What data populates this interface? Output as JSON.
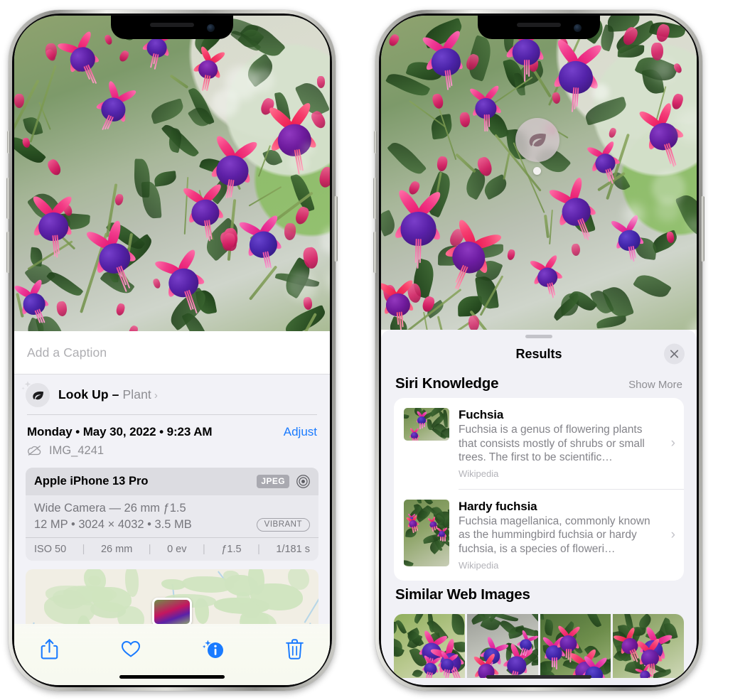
{
  "left_phone": {
    "name": "iPhone photo detail view",
    "photo": {
      "alt": "Fuchsia flowers hanging basket"
    },
    "caption_field": {
      "placeholder": "Add a Caption",
      "value": ""
    },
    "look_up": {
      "icon": "leaf-icon",
      "sparkle_icon": "sparkles-icon",
      "label": "Look Up",
      "separator": "–",
      "subject": "Plant",
      "chevron": "›"
    },
    "date_row": {
      "date": "Monday • May 30, 2022 • 9:23 AM",
      "adjust_label": "Adjust"
    },
    "file_row": {
      "icon": "cloud-slash-icon",
      "filename": "IMG_4241"
    },
    "exif": {
      "device": "Apple iPhone 13 Pro",
      "format_badge": "JPEG",
      "aperture_icon": "lens-icon",
      "lens": "Wide Camera — 26 mm ƒ1.5",
      "size_line": "12 MP • 3024 × 4032 • 3.5 MB",
      "style_badge": "VIBRANT",
      "settings": [
        "ISO 50",
        "26 mm",
        "0 ev",
        "ƒ1.5",
        "1/181 s"
      ]
    },
    "map": {
      "alt": "Map showing photo location",
      "pin": "photo-thumbnail-pin"
    },
    "toolbar": [
      {
        "name": "share-button",
        "icon": "share-icon"
      },
      {
        "name": "favorite-button",
        "icon": "heart-icon"
      },
      {
        "name": "info-button",
        "icon": "info-sparkle-icon"
      },
      {
        "name": "delete-button",
        "icon": "trash-icon"
      }
    ],
    "accent_color": "#1a7bff"
  },
  "right_phone": {
    "name": "Visual Look Up results",
    "visual_lookup_badge": {
      "icon": "leaf-icon",
      "label": "Visual Look Up"
    },
    "results_sheet": {
      "grabber": "drag-handle",
      "title": "Results",
      "close_icon": "close-icon",
      "sections": [
        {
          "title": "Siri Knowledge",
          "action_label": "Show More",
          "items": [
            {
              "title": "Fuchsia",
              "description": "Fuchsia is a genus of flowering plants that consists mostly of shrubs or small trees. The first to be scientific…",
              "source": "Wikipedia",
              "thumb": "fuchsia-red-flowers-thumbnail",
              "chevron": "›"
            },
            {
              "title": "Hardy fuchsia",
              "description": "Fuchsia magellanica, commonly known as the hummingbird fuchsia or hardy fuchsia, is a species of floweri…",
              "source": "Wikipedia",
              "thumb": "hardy-fuchsia-branch-thumbnail",
              "chevron": "›"
            }
          ]
        },
        {
          "title": "Similar Web Images",
          "images": [
            {
              "alt": "Pink and magenta fuchsia with green leaves"
            },
            {
              "alt": "Close-up of red fuchsia blossoms"
            },
            {
              "alt": "Fuchsia shrub with many buds"
            },
            {
              "alt": "Purple and red fuchsia cluster"
            }
          ]
        }
      ]
    }
  },
  "colors": {
    "accent_blue": "#1a7bff",
    "sheet_bg": "#f2f2f7",
    "card_bg": "#ffffff",
    "muted_text": "#8e8e93"
  }
}
